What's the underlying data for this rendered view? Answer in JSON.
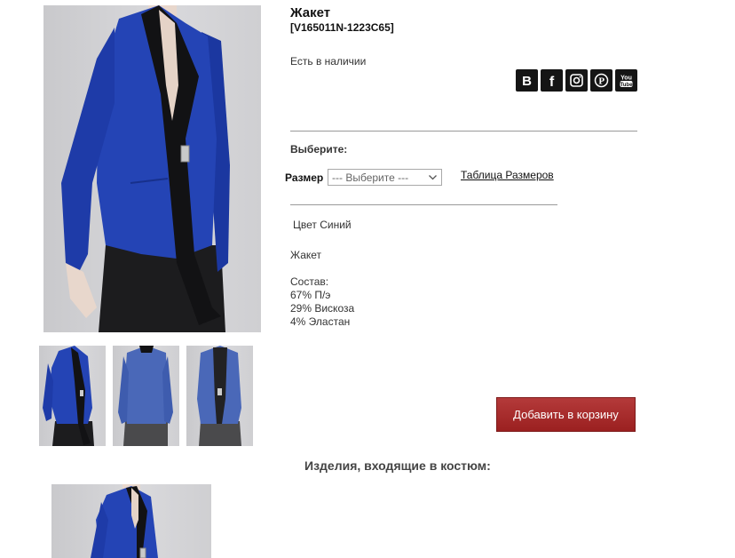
{
  "product": {
    "title": "Жакет",
    "sku": "[V165011N-1223C65]",
    "availability": "Есть в наличии"
  },
  "social": [
    {
      "name": "vk-icon",
      "glyph": "B"
    },
    {
      "name": "facebook-icon",
      "glyph": "f"
    },
    {
      "name": "instagram-icon",
      "glyph": ""
    },
    {
      "name": "pinterest-icon",
      "glyph": ""
    },
    {
      "name": "youtube-icon",
      "glyph": "You Tube"
    }
  ],
  "options": {
    "choose_label": "Выберите:",
    "size_label": "Размер",
    "size_select_value": "--- Выберите ---",
    "size_chart_link": "Таблица Размеров"
  },
  "details": {
    "color": "Цвет Синий",
    "description": "Жакет",
    "composition_label": "Состав:",
    "composition": [
      "67% П/э",
      "29% Вискоза",
      "4% Эластан"
    ]
  },
  "cart_button": "Добавить в корзину",
  "suit_section": {
    "heading": "Изделия, входящие в костюм:"
  },
  "colors": {
    "jacket_blue": "#1f3fae",
    "jacket_light_blue": "#4a68b8",
    "cart_red": "#a52828"
  }
}
